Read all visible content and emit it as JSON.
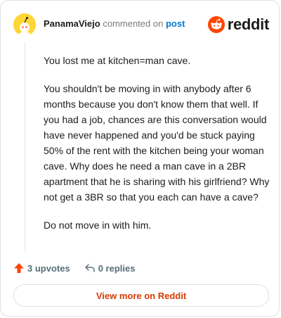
{
  "header": {
    "username": "PanamaViejo",
    "action_text": "commented on",
    "post_link": "post",
    "logo_text": "reddit"
  },
  "comment": {
    "paragraphs": [
      "You lost me at kitchen=man cave.",
      "You shouldn't be moving in with anybody after 6 months because you don't know them that well. If you had a job, chances are this conversation would have never happened and you'd be stuck paying 50% of the rent with the kitchen being your woman cave. Why does he need a man cave in a 2BR apartment that he is sharing with his girlfriend? Why not get a 3BR so that you each can have a cave?",
      "Do not move in with him."
    ]
  },
  "footer": {
    "upvotes_label": "3 upvotes",
    "replies_label": "0 replies"
  },
  "cta": {
    "view_more_label": "View more on Reddit"
  },
  "colors": {
    "accent_orange": "#ff4500",
    "link_blue": "#0079d3",
    "cta_text": "#d93a00",
    "avatar_yellow": "#ffd635"
  },
  "icons": {
    "avatar": "snoo-avatar-icon",
    "logo": "reddit-logo-icon",
    "upvote": "upvote-arrow-icon",
    "reply": "reply-arrow-icon"
  }
}
